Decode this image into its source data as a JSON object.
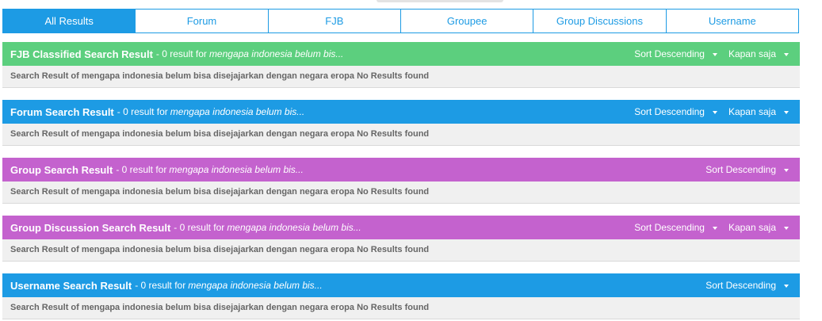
{
  "colors": {
    "blue": "#1d9be4",
    "green": "#5ccf7e",
    "purple": "#c462ce",
    "body_bg": "#f0f0f0",
    "body_text": "#666666"
  },
  "tabs": [
    {
      "label": "All Results",
      "active": true
    },
    {
      "label": "Forum",
      "active": false
    },
    {
      "label": "FJB",
      "active": false
    },
    {
      "label": "Groupee",
      "active": false
    },
    {
      "label": "Group Discussions",
      "active": false
    },
    {
      "label": "Username",
      "active": false
    }
  ],
  "sections": {
    "fjb": {
      "title": "FJB Classified Search Result",
      "sub": "- 0 result for",
      "query": "mengapa indonesia belum bis...",
      "sort_label": "Sort Descending",
      "time_label": "Kapan saja",
      "body": "Search Result of mengapa indonesia belum bisa disejajarkan dengan negara eropa No Results found",
      "color": "#5ccf7e"
    },
    "forum": {
      "title": "Forum Search Result",
      "sub": "- 0 result for",
      "query": "mengapa indonesia belum bis...",
      "sort_label": "Sort Descending",
      "time_label": "Kapan saja",
      "body": "Search Result of mengapa indonesia belum bisa disejajarkan dengan negara eropa No Results found",
      "color": "#1d9be4"
    },
    "group": {
      "title": "Group Search Result",
      "sub": "- 0 result for",
      "query": "mengapa indonesia belum bis...",
      "sort_label": "Sort Descending",
      "body": "Search Result of mengapa indonesia belum bisa disejajarkan dengan negara eropa No Results found",
      "color": "#c462ce"
    },
    "group_discussion": {
      "title": "Group Discussion Search Result",
      "sub": "- 0 result for",
      "query": "mengapa indonesia belum bis...",
      "sort_label": "Sort Descending",
      "time_label": "Kapan saja",
      "body": "Search Result of mengapa indonesia belum bisa disejajarkan dengan negara eropa No Results found",
      "color": "#c462ce"
    },
    "username": {
      "title": "Username Search Result",
      "sub": "- 0 result for",
      "query": "mengapa indonesia belum bis...",
      "sort_label": "Sort Descending",
      "body": "Search Result of mengapa indonesia belum bisa disejajarkan dengan negara eropa No Results found",
      "color": "#1d9be4"
    }
  }
}
